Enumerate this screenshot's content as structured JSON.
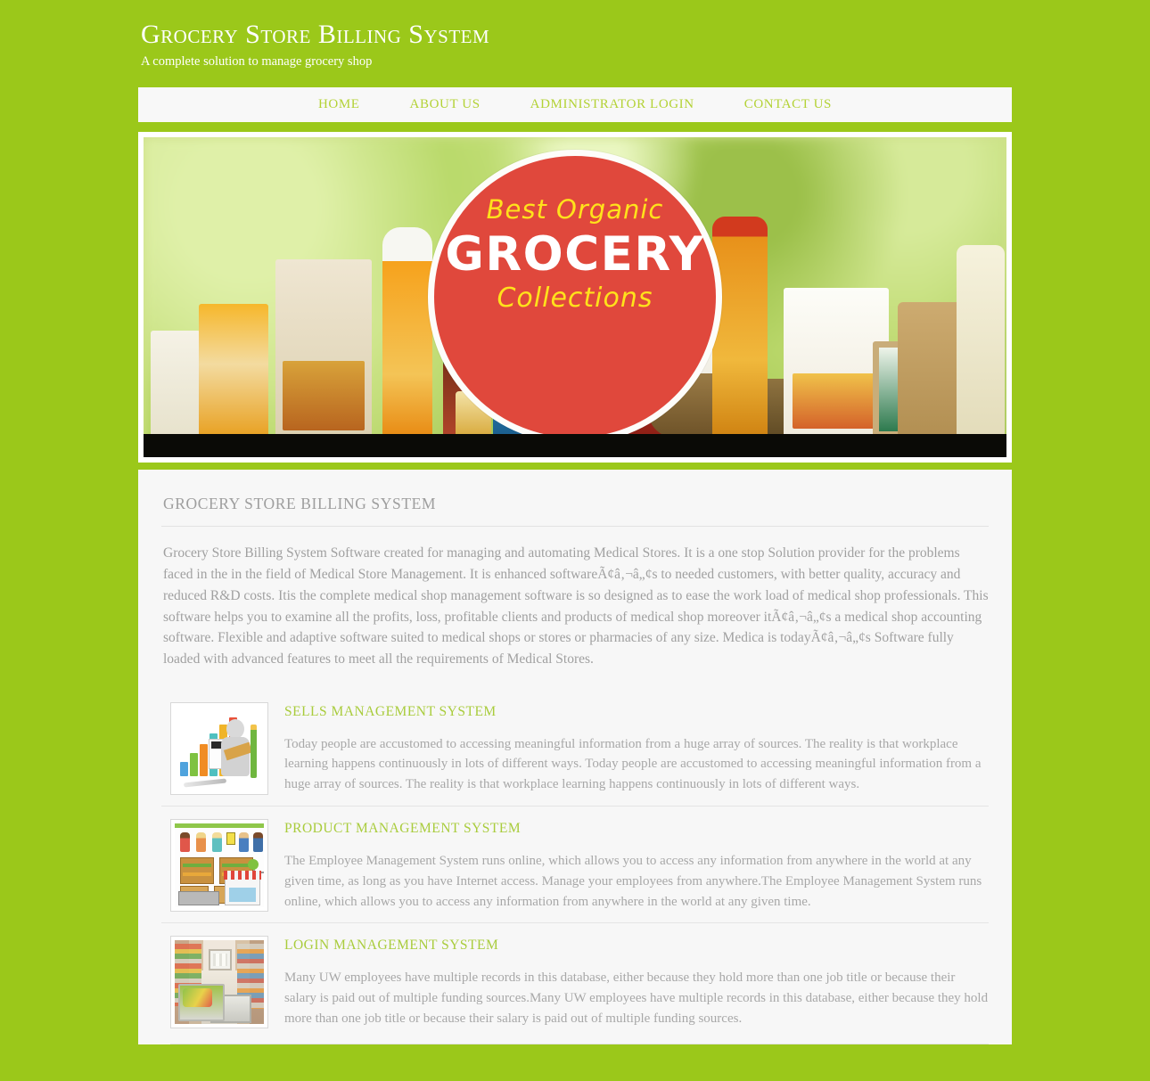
{
  "header": {
    "title": "Grocery Store Billing System",
    "tagline": "A complete solution to manage grocery shop"
  },
  "nav": {
    "items": [
      {
        "label": "HOME"
      },
      {
        "label": "ABOUT US"
      },
      {
        "label": "ADMINISTRATOR LOGIN"
      },
      {
        "label": "CONTACT US"
      }
    ]
  },
  "banner": {
    "line1": "Best Organic",
    "line2": "GROCERY",
    "line3": "Collections",
    "alt": "best-organic-grocery-collections-banner"
  },
  "main": {
    "section_title": "GROCERY STORE BILLING SYSTEM",
    "intro": "Grocery Store Billing System Software created for managing and automating Medical Stores. It is a one stop Solution provider for the problems faced in the in the field of Medical Store Management. It is enhanced softwareÃ¢â‚¬â„¢s to needed customers, with better quality, accuracy and reduced R&D costs. Itis the complete medical shop management software is so designed as to ease the work load of medical shop professionals. This software helps you to examine all the profits, loss, profitable clients and products of medical shop moreover itÃ¢â‚¬â„¢s a medical shop accounting software. Flexible and adaptive software suited to medical shops or stores or pharmacies of any size. Medica is todayÃ¢â‚¬â„¢s Software fully loaded with advanced features to meet all the requirements of Medical Stores.",
    "features": [
      {
        "title": "SELLS MANAGEMENT SYSTEM",
        "text": "Today people are accustomed to accessing meaningful information from a huge array of sources. The reality is that workplace learning happens continuously in lots of different ways. Today people are accustomed to accessing meaningful information from a huge array of sources. The reality is that workplace learning happens continuously in lots of different ways.",
        "thumb_alt": "sales-chart-thumbnail"
      },
      {
        "title": "PRODUCT MANAGEMENT SYSTEM",
        "text": "The Employee Management System runs online, which allows you to access any information from anywhere in the world at any given time, as long as you have Internet access. Manage your employees from anywhere.The Employee Management System runs online, which allows you to access any information from anywhere in the world at any given time.",
        "thumb_alt": "grocery-clipart-thumbnail"
      },
      {
        "title": "LOGIN MANAGEMENT SYSTEM",
        "text": "Many UW employees have multiple records in this database, either because they hold more than one job title or because their salary is paid out of multiple funding sources.Many UW employees have multiple records in this database, either because they hold more than one job title or because their salary is paid out of multiple funding sources.",
        "thumb_alt": "store-aisle-thumbnail"
      }
    ]
  },
  "colors": {
    "page_background": "#9bc81a",
    "nav_link": "#b3d235",
    "feature_title": "#a9cc3c",
    "body_text": "#a8a8a8",
    "banner_circle": "#e0483c",
    "banner_accent": "#ffe21b"
  }
}
